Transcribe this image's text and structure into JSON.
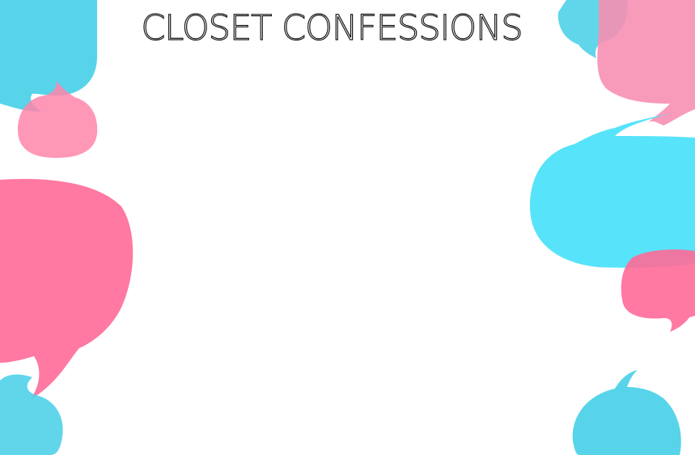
{
  "title": "CLOSET CONFESSIONS",
  "colors": {
    "cyan": "#4fd2e8",
    "cyan_bright": "#57e3fb",
    "pink": "#ff7aa3",
    "pink_light": "#f797b6",
    "overlap": "#8a7cb0"
  }
}
